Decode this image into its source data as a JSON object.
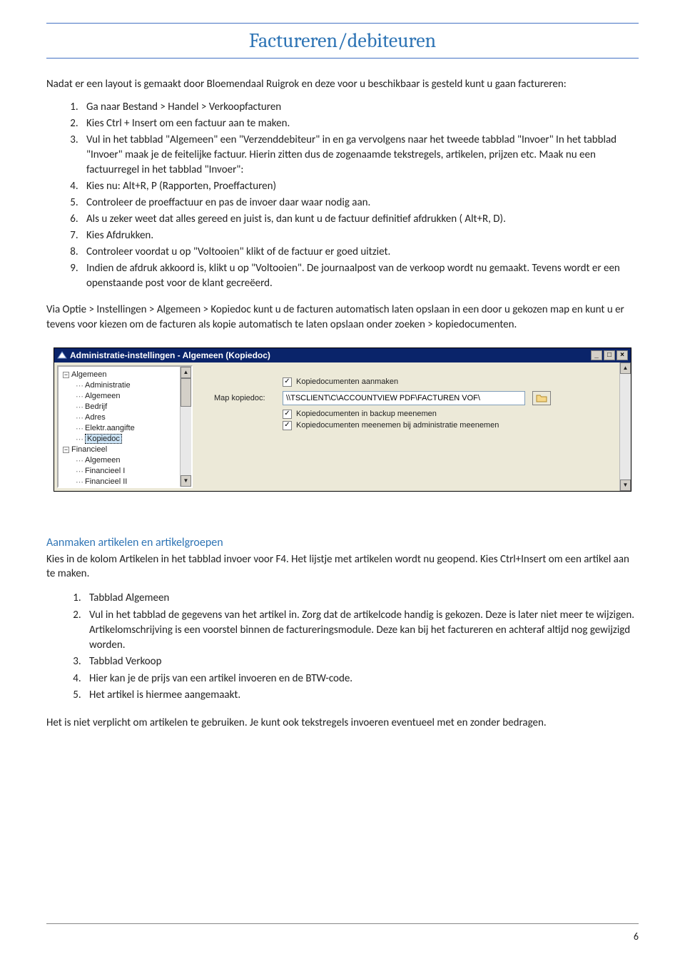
{
  "header": {
    "title": "Factureren/debiteuren"
  },
  "intro": "Nadat er een layout is gemaakt door Bloemendaal Ruigrok en deze voor u beschikbaar is gesteld kunt u gaan factureren:",
  "list1": [
    "Ga naar Bestand > Handel > Verkoopfacturen",
    "Kies Ctrl + Insert om een factuur aan te maken.",
    "Vul in het tabblad \"Algemeen\" een \"Verzenddebiteur\" in en ga vervolgens naar het tweede tabblad \"Invoer\" In het tabblad \"Invoer\" maak je de feitelijke factuur. Hierin zitten dus de zogenaamde tekstregels, artikelen, prijzen etc. Maak nu een factuurregel in het tabblad \"Invoer\":",
    "Kies nu: Alt+R, P (Rapporten, Proeffacturen)",
    "Controleer de proeffactuur en pas de invoer daar waar nodig aan.",
    "Als u zeker weet dat alles gereed en juist is, dan kunt u de factuur definitief afdrukken ( Alt+R, D).",
    "Kies Afdrukken.",
    "Controleer voordat u op \"Voltooien\" klikt of de factuur er goed uitziet.",
    " Indien de afdruk akkoord is, klikt u op \"Voltooien\". De journaalpost van de verkoop wordt nu gemaakt. Tevens wordt er een openstaande post voor de klant gecreëerd."
  ],
  "para2": "Via Optie > Instellingen > Algemeen  > Kopiedoc kunt u de facturen automatisch laten opslaan in een door u gekozen map en kunt u er tevens voor kiezen om de facturen als kopie automatisch te laten opslaan onder zoeken > kopiedocumenten.",
  "app": {
    "title": "Administratie-instellingen - Algemeen (Kopiedoc)",
    "tree": [
      {
        "lvl": 0,
        "box": "minus",
        "label": "Algemeen"
      },
      {
        "lvl": 1,
        "box": "",
        "label": "Administratie"
      },
      {
        "lvl": 1,
        "box": "",
        "label": "Algemeen"
      },
      {
        "lvl": 1,
        "box": "",
        "label": "Bedrijf"
      },
      {
        "lvl": 1,
        "box": "",
        "label": "Adres"
      },
      {
        "lvl": 1,
        "box": "",
        "label": "Elektr.aangifte"
      },
      {
        "lvl": 1,
        "box": "",
        "label": "Kopiedoc",
        "selected": true
      },
      {
        "lvl": 0,
        "box": "minus",
        "label": "Financieel"
      },
      {
        "lvl": 1,
        "box": "",
        "label": "Algemeen"
      },
      {
        "lvl": 1,
        "box": "",
        "label": "Financieel I"
      },
      {
        "lvl": 1,
        "box": "",
        "label": "Financieel II"
      }
    ],
    "form": {
      "chk1": "Kopiedocumenten aanmaken",
      "field_label": "Map kopiedoc:",
      "field_value": "\\\\TSCLIENT\\C\\ACCOUNTVIEW PDF\\FACTUREN VOF\\",
      "chk2": "Kopiedocumenten in backup meenemen",
      "chk3": "Kopiedocumenten meenemen bij administratie meenemen"
    }
  },
  "subheading": "Aanmaken artikelen en artikelgroepen",
  "para3": "Kies in de kolom Artikelen in het tabblad invoer voor F4. Het lijstje met artikelen wordt nu geopend. Kies Ctrl+Insert om een artikel aan te maken.",
  "list2": [
    "Tabblad Algemeen",
    "Vul in het tabblad de gegevens van het artikel in. Zorg dat de artikelcode handig is gekozen. Deze is later niet meer te wijzigen. Artikelomschrijving is een voorstel binnen de factureringsmodule. Deze kan bij het factureren en achteraf altijd nog gewijzigd worden.",
    "Tabblad Verkoop",
    "Hier kan je de prijs van een artikel invoeren en de BTW-code.",
    "Het artikel is hiermee aangemaakt."
  ],
  "closing": "Het is niet verplicht om artikelen te gebruiken. Je kunt ook tekstregels invoeren eventueel met en zonder bedragen.",
  "page_number": "6"
}
